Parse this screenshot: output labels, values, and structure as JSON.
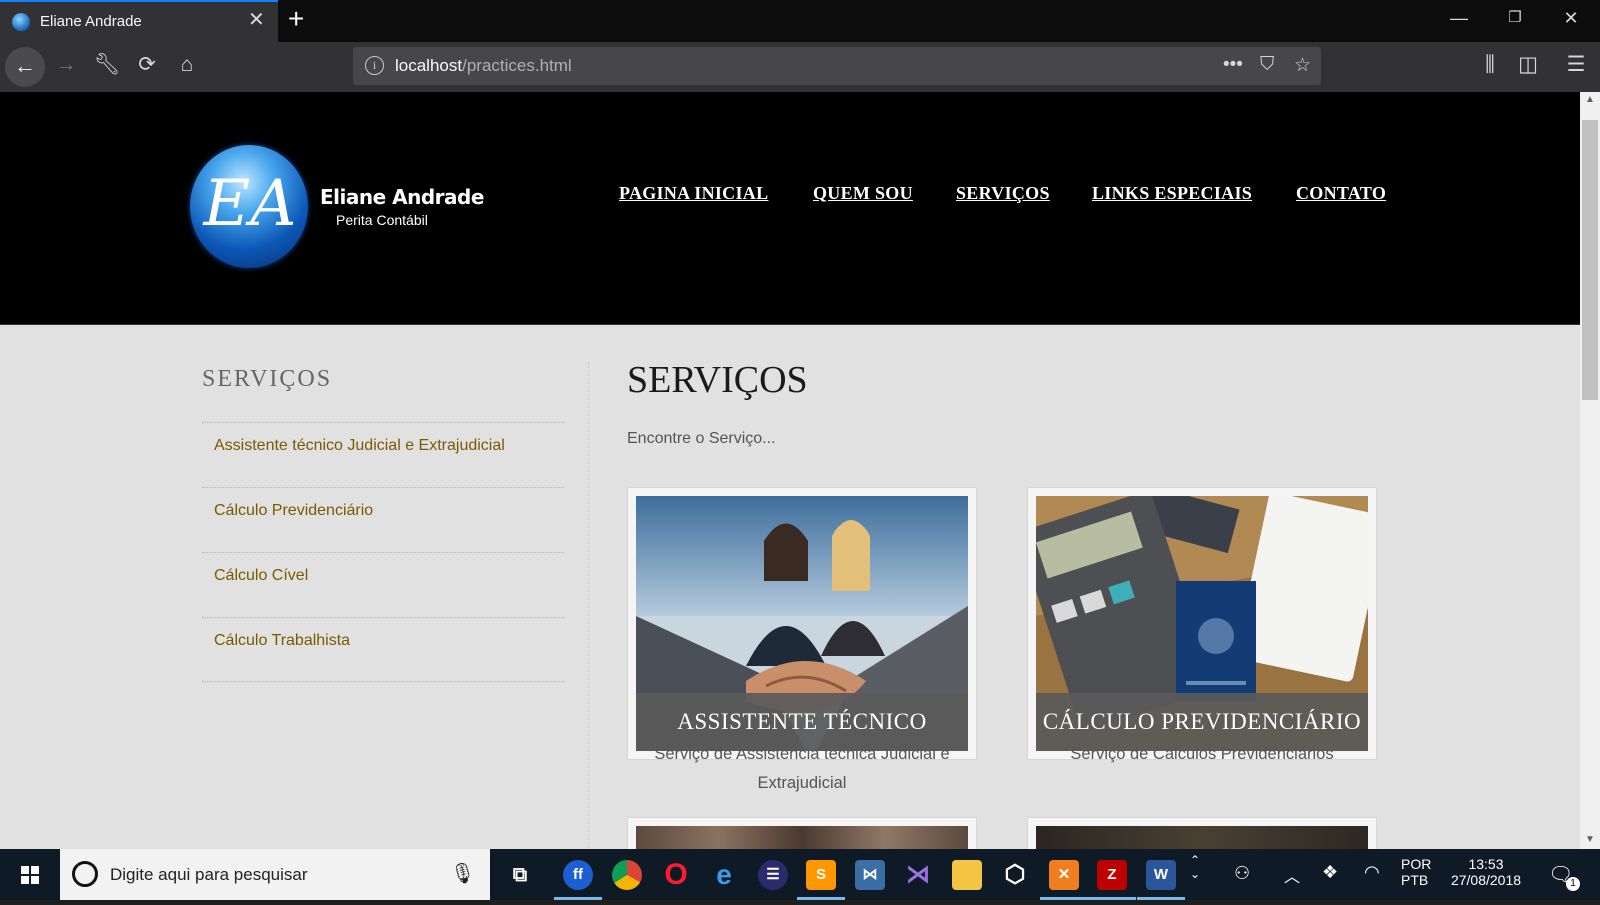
{
  "browser": {
    "tab_title": "Eliane Andrade",
    "url_host": "localhost",
    "url_path": "/practices.html"
  },
  "site": {
    "brand_name": "Eliane Andrade",
    "brand_subtitle": "Perita Contábil",
    "logo_monogram": "EA",
    "nav": [
      "PAGINA INICIAL",
      "QUEM SOU",
      "SERVIÇOS",
      "LINKS ESPECIAIS",
      "CONTATO"
    ],
    "sidebar_title": "SERVIÇOS",
    "sidebar_items": [
      "Assistente técnico Judicial e Extrajudicial",
      "Cálculo Previdenciário",
      "Cálculo Cível",
      "Cálculo Trabalhista"
    ],
    "page_title": "SERVIÇOS",
    "page_subtitle": "Encontre o Serviço...",
    "cards": [
      {
        "label": "ASSISTENTE TÉCNICO",
        "description": "Serviço de Assistencia técnica Judicial e Extrajudicial"
      },
      {
        "label": "CÁLCULO PREVIDENCIÁRIO",
        "description": "Serviço de Cálculos Previdenciários"
      }
    ]
  },
  "taskbar": {
    "search_placeholder": "Digite aqui para pesquisar",
    "lang_top": "POR",
    "lang_bottom": "PTB",
    "time": "13:53",
    "date": "27/08/2018",
    "notification_count": "1"
  },
  "colors": {
    "accent": "#0a84ff",
    "sidebar_link": "#7a5a00",
    "header_bg": "#000000",
    "page_bg": "#e1e1e1"
  }
}
